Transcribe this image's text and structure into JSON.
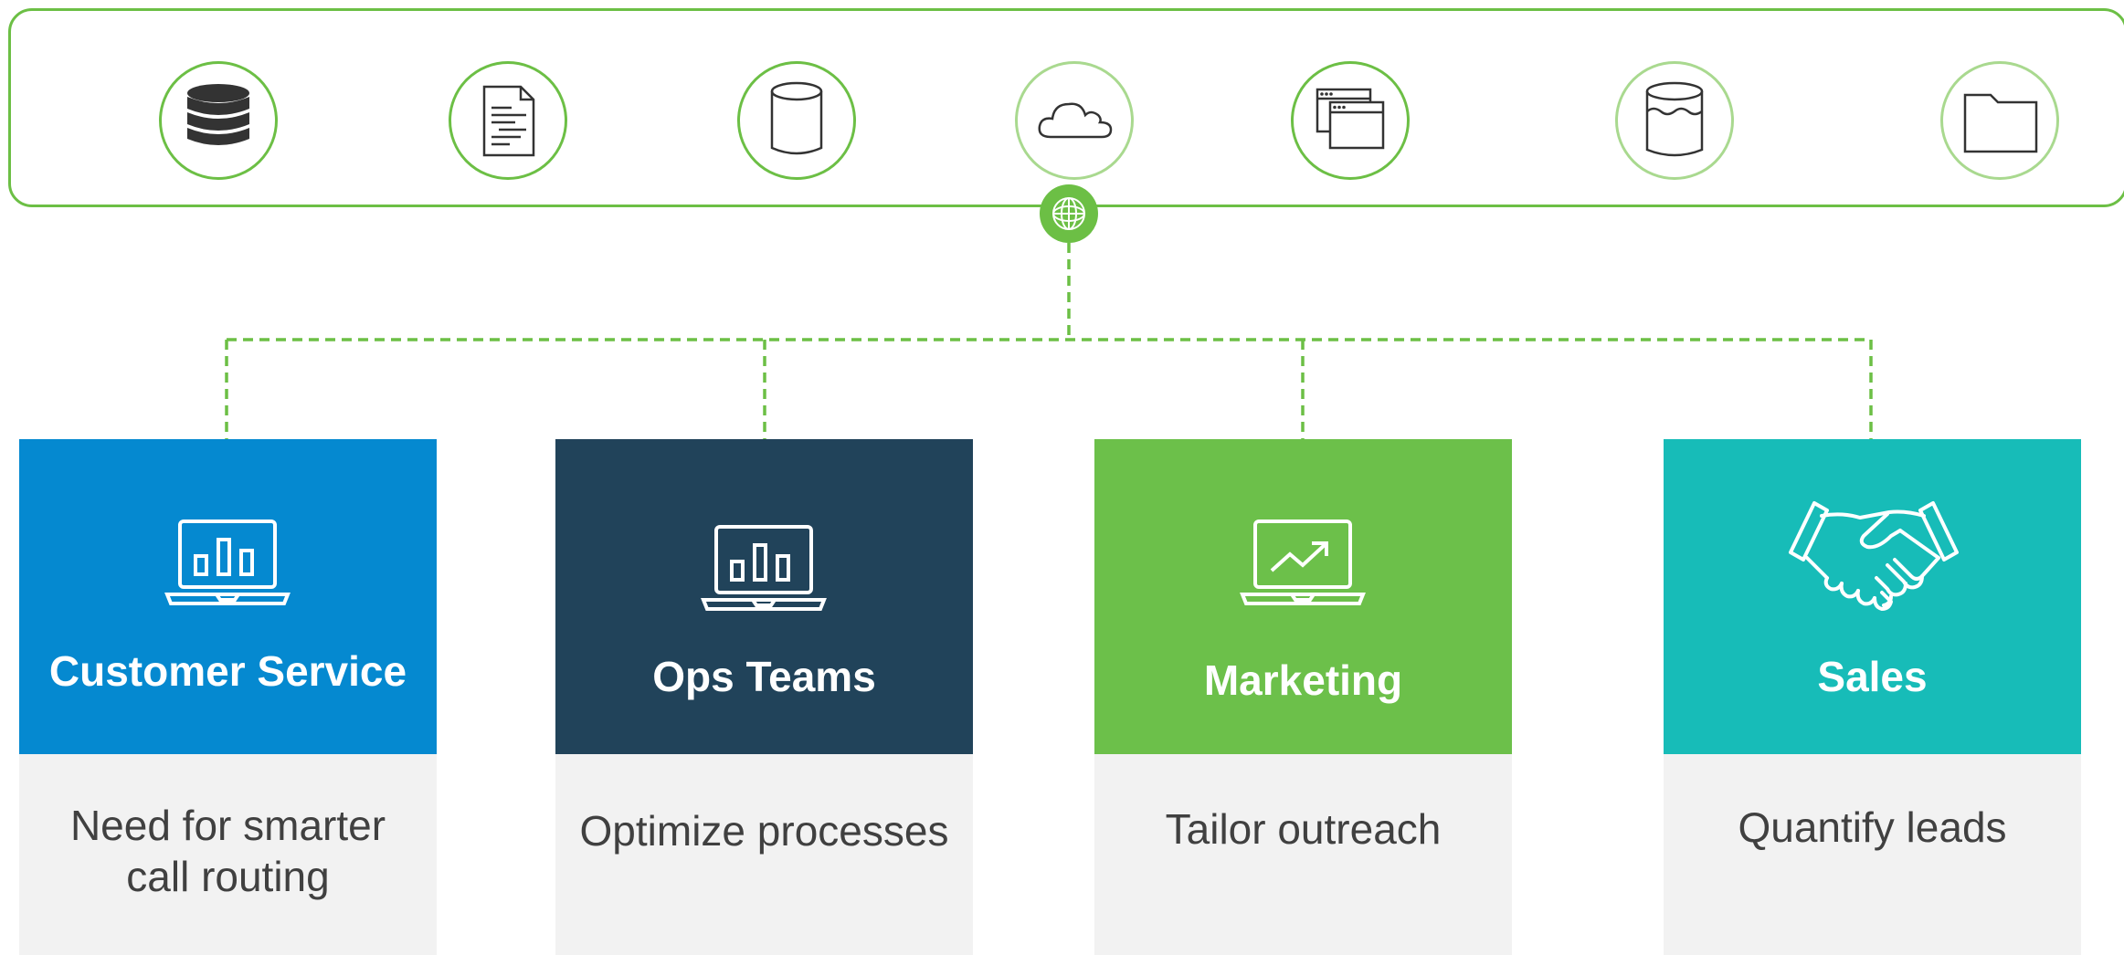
{
  "colors": {
    "accent_green": "#6cbf45",
    "light_green": "#a9d98f",
    "panel_grey": "#f2f2f2",
    "text_dark": "#404040",
    "icon_dark": "#333333"
  },
  "sources": [
    {
      "icon": "database-stack-icon"
    },
    {
      "icon": "document-icon"
    },
    {
      "icon": "cylinder-icon"
    },
    {
      "icon": "cloud-icon"
    },
    {
      "icon": "browser-windows-icon"
    },
    {
      "icon": "data-lake-icon"
    },
    {
      "icon": "folder-icon"
    }
  ],
  "hub": {
    "icon": "connector-hub-icon"
  },
  "teams": [
    {
      "title": "Customer Service",
      "description": "Need for smarter call routing",
      "color": "#0589d0",
      "icon": "laptop-bar-chart-icon"
    },
    {
      "title": "Ops Teams",
      "description": "Optimize processes",
      "color": "#21435a",
      "icon": "laptop-bar-chart-icon"
    },
    {
      "title": "Marketing",
      "description": "Tailor outreach",
      "color": "#6cc04a",
      "icon": "laptop-trend-icon"
    },
    {
      "title": "Sales",
      "description": "Quantify leads",
      "color": "#17bcb8",
      "icon": "handshake-icon"
    }
  ]
}
